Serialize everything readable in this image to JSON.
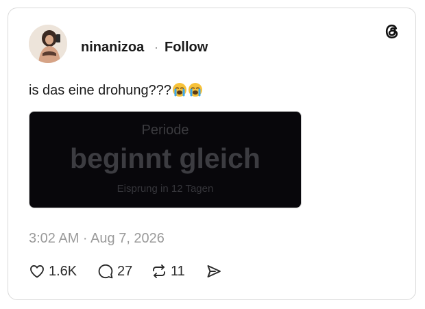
{
  "post": {
    "username": "ninanizoa",
    "separator": "·",
    "follow_label": "Follow",
    "text": "is das eine drohung???",
    "emojis": [
      "loudly-crying-face",
      "loudly-crying-face"
    ],
    "media": {
      "line1": "Periode",
      "line2": "beginnt gleich",
      "line3": "Eisprung in 12 Tagen"
    },
    "timestamp": "3:02 AM · Aug 7, 2026",
    "actions": {
      "likes": "1.6K",
      "replies": "27",
      "reposts": "11"
    }
  },
  "icons": {
    "brand": "threads-logo-icon",
    "like": "heart-icon",
    "reply": "comment-bubble-icon",
    "repost": "repost-icon",
    "share": "send-icon"
  },
  "colors": {
    "media_background": "#08070b",
    "emoji_face": "#f7c23a",
    "emoji_tears": "#39a7ee"
  }
}
